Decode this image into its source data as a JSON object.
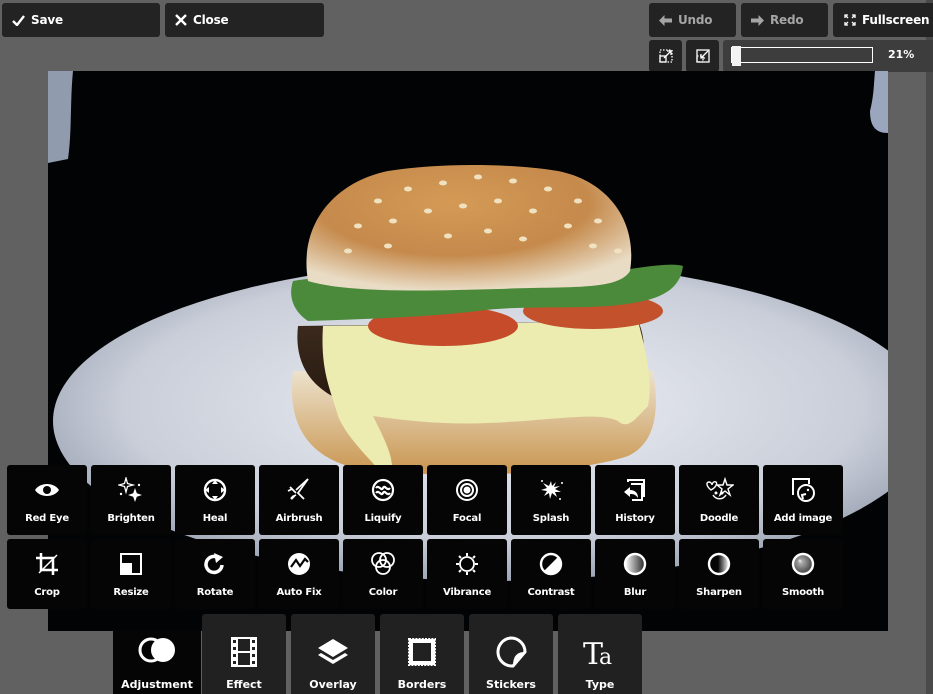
{
  "toolbar": {
    "save_label": "Save",
    "close_label": "Close",
    "undo_label": "Undo",
    "redo_label": "Redo",
    "fullscreen_label": "Fullscreen",
    "zoom_value_label": "21%",
    "zoom_fraction": 0.0
  },
  "image": {
    "subject": "Cheeseburger with sesame bun, lettuce, tomato and cheese on white plate against black background"
  },
  "tools": [
    {
      "label": "Red Eye",
      "icon": "eye-icon"
    },
    {
      "label": "Brighten",
      "icon": "sparkles-icon"
    },
    {
      "label": "Heal",
      "icon": "heal-icon"
    },
    {
      "label": "Airbrush",
      "icon": "airbrush-icon"
    },
    {
      "label": "Liquify",
      "icon": "liquify-icon"
    },
    {
      "label": "Focal",
      "icon": "target-icon"
    },
    {
      "label": "Splash",
      "icon": "splash-icon"
    },
    {
      "label": "History",
      "icon": "history-icon"
    },
    {
      "label": "Doodle",
      "icon": "doodle-icon"
    },
    {
      "label": "Add image",
      "icon": "add-image-icon"
    },
    {
      "label": "Crop",
      "icon": "crop-icon"
    },
    {
      "label": "Resize",
      "icon": "resize-icon"
    },
    {
      "label": "Rotate",
      "icon": "rotate-icon"
    },
    {
      "label": "Auto Fix",
      "icon": "auto-fix-icon"
    },
    {
      "label": "Color",
      "icon": "color-icon"
    },
    {
      "label": "Vibrance",
      "icon": "vibrance-icon"
    },
    {
      "label": "Contrast",
      "icon": "contrast-icon"
    },
    {
      "label": "Blur",
      "icon": "blur-icon"
    },
    {
      "label": "Sharpen",
      "icon": "sharpen-icon"
    },
    {
      "label": "Smooth",
      "icon": "smooth-icon"
    }
  ],
  "tabs": [
    {
      "label": "Adjustment",
      "icon": "adjustment-icon",
      "active": true
    },
    {
      "label": "Effect",
      "icon": "film-icon",
      "active": false
    },
    {
      "label": "Overlay",
      "icon": "layers-icon",
      "active": false
    },
    {
      "label": "Borders",
      "icon": "border-icon",
      "active": false
    },
    {
      "label": "Stickers",
      "icon": "sticker-icon",
      "active": false
    },
    {
      "label": "Type",
      "icon": "type-icon",
      "active": false
    }
  ]
}
